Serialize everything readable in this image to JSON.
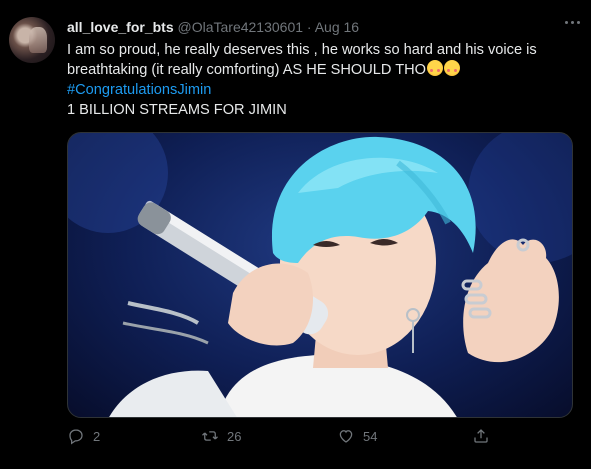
{
  "tweet": {
    "display_name": "all_love_for_bts",
    "handle": "@OlaTare42130601",
    "separator": "·",
    "date": "Aug 16",
    "text_line1": "I am so proud,  he really deserves this , he works so hard and his voice is",
    "text_line2": "breathtaking (it really comforting) AS HE SHOULD THO",
    "hashtag": "#CongratulationsJimin",
    "text_line4": "1 BILLION STREAMS FOR JIMIN",
    "emojis": [
      "smiling-face-with-hearts",
      "smiling-face-with-hearts"
    ]
  },
  "actions": {
    "reply_count": "2",
    "retweet_count": "26",
    "like_count": "54",
    "share_label": ""
  },
  "colors": {
    "background": "#000000",
    "text": "#e7e9ea",
    "muted": "#71767b",
    "link": "#1d9bf0",
    "hair": "#5ad2ee"
  }
}
